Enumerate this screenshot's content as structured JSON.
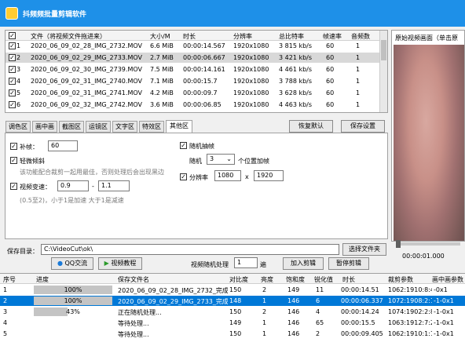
{
  "app": {
    "title": "抖频频批量剪辑软件"
  },
  "file_table": {
    "headers": [
      "文件（将视频文件拖进来）",
      "大小/M",
      "时长",
      "分辨率",
      "总比特率",
      "帧速率",
      "音频数"
    ],
    "rows": [
      {
        "no": "1",
        "file": "2020_06_09_02_28_IMG_2732.MOV",
        "size": "6.6 MiB",
        "duration": "00:00:14.567",
        "resolution": "1920x1080",
        "bitrate": "3 815 kb/s",
        "fps": "60",
        "audio": "1",
        "checked": true
      },
      {
        "no": "2",
        "file": "2020_06_09_02_29_IMG_2733.MOV",
        "size": "2.7 MiB",
        "duration": "00:00:06.667",
        "resolution": "1920x1080",
        "bitrate": "3 421 kb/s",
        "fps": "60",
        "audio": "1",
        "checked": true
      },
      {
        "no": "3",
        "file": "2020_06_09_02_30_IMG_2739.MOV",
        "size": "7.5 MiB",
        "duration": "00:00:14.161",
        "resolution": "1920x1080",
        "bitrate": "4 461 kb/s",
        "fps": "60",
        "audio": "1",
        "checked": true
      },
      {
        "no": "4",
        "file": "2020_06_09_02_31_IMG_2740.MOV",
        "size": "7.1 MiB",
        "duration": "00:00:15.7",
        "resolution": "1920x1080",
        "bitrate": "3 788 kb/s",
        "fps": "60",
        "audio": "1",
        "checked": true
      },
      {
        "no": "5",
        "file": "2020_06_09_02_31_IMG_2741.MOV",
        "size": "4.2 MiB",
        "duration": "00:00:09.7",
        "resolution": "1920x1080",
        "bitrate": "3 628 kb/s",
        "fps": "60",
        "audio": "1",
        "checked": true
      },
      {
        "no": "6",
        "file": "2020_06_09_02_32_IMG_2742.MOV",
        "size": "3.6 MiB",
        "duration": "00:00:06.85",
        "resolution": "1920x1080",
        "bitrate": "4 463 kb/s",
        "fps": "60",
        "audio": "1",
        "checked": true
      }
    ]
  },
  "preview": {
    "title": "原始视频画面（单击原",
    "time": "00:00:01.000"
  },
  "tabs": [
    "调色区",
    "画中画",
    "截图区",
    "运镜区",
    "文字区",
    "特效区",
    "其他区"
  ],
  "active_tab": "其他区",
  "buttons": {
    "restore": "恢复默认",
    "save_settings": "保存设置",
    "choose_folder": "选择文件夹",
    "qq": "QQ交流",
    "tutorial": "视频教程",
    "add_edit": "加入剪辑",
    "pause_edit": "暂停剪辑"
  },
  "settings": {
    "fill_frames_label": "补帧：",
    "fill_frames_value": "60",
    "slight_tilt_label": "轻微倾斜",
    "tilt_hint": "该功能配合裁剪一起用最佳，否则处理后会出现黑边",
    "speed_label": "视频变速：",
    "speed_min": "0.9",
    "speed_dash": "-",
    "speed_max": "1.1",
    "speed_hint": "(0.5至2)，小于1是加速 大于1是减速",
    "random_drop_label": "随机抽帧",
    "random_label": "随机",
    "random_value": "3",
    "random_suffix": "个位置加帧",
    "resolution_label": "分辨率",
    "res_w": "1080",
    "res_x": "x",
    "res_h": "1920"
  },
  "save_dir": {
    "label": "保存目录：",
    "value": "C:\\VideoCut\\ok\\"
  },
  "random_process": {
    "label": "视频随机处理",
    "value": "1",
    "suffix": "遍"
  },
  "output_table": {
    "headers": [
      "序号",
      "进度",
      "保存文件名",
      "对比度",
      "亮度",
      "饱和度",
      "锐化值",
      "时长",
      "裁剪参数",
      "画中画参数"
    ],
    "rows": [
      {
        "no": "1",
        "progress": 100,
        "progress_text": "100%",
        "name": "2020_06_09_02_28_IMG_2732_完成",
        "contrast": "150",
        "brightness": "2",
        "saturation": "149",
        "sharpen": "11",
        "duration": "00:00:14.51",
        "crop": "1062:1910:8:4996:-1",
        "pip": "-0x1"
      },
      {
        "no": "2",
        "progress": 100,
        "progress_text": "100%",
        "name": "2020_06_09_02_29_IMG_2733_完成",
        "contrast": "148",
        "brightness": "1",
        "saturation": "146",
        "sharpen": "6",
        "duration": "00:00:06.337",
        "crop": "1072:1908:2:1952:",
        "pip": "-1-0x1"
      },
      {
        "no": "3",
        "progress": 43,
        "progress_text": "43%",
        "name": "正在随机处理...",
        "contrast": "150",
        "brightness": "2",
        "saturation": "146",
        "sharpen": "4",
        "duration": "00:00:14.24",
        "crop": "1074:1902:2:8970:",
        "pip": "-1-0x1"
      },
      {
        "no": "4",
        "progress": 0,
        "progress_text": "",
        "name": "等待处理...",
        "contrast": "149",
        "brightness": "1",
        "saturation": "146",
        "sharpen": "65",
        "duration": "00:00:15.5",
        "crop": "1063:1912:7:2986:",
        "pip": "-1-0x1"
      },
      {
        "no": "5",
        "progress": 0,
        "progress_text": "",
        "name": "等待处理...",
        "contrast": "150",
        "brightness": "1",
        "saturation": "146",
        "sharpen": "2",
        "duration": "00:00:09.405",
        "crop": "1062:1910:1:1055:",
        "pip": "-1-0x1"
      }
    ]
  },
  "colors": {
    "titlebar": "#1e90e8",
    "selection": "#0078d7"
  }
}
